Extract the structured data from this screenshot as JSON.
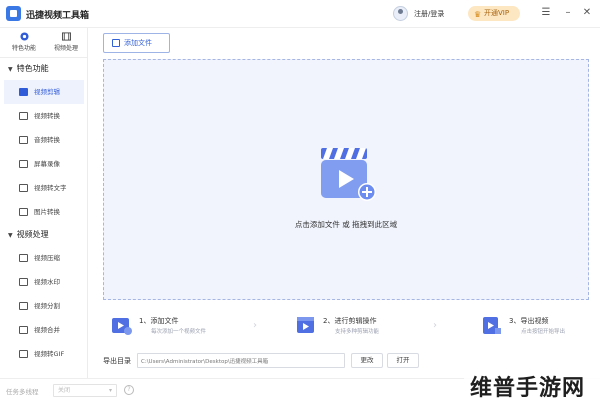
{
  "app": {
    "title": "迅捷视频工具箱"
  },
  "header": {
    "login_label": "注册/登录",
    "vip_label": "开通VIP"
  },
  "sidebar": {
    "top_tabs": [
      {
        "label": "特色功能"
      },
      {
        "label": "视频处理"
      }
    ],
    "sections": [
      {
        "title": "特色功能",
        "items": [
          "视频剪辑",
          "视频转换",
          "音频转换",
          "屏幕录像",
          "视频转文字",
          "图片转换"
        ]
      },
      {
        "title": "视频处理",
        "items": [
          "视频压缩",
          "视频水印",
          "视频分割",
          "视频合并",
          "视频转GIF"
        ]
      }
    ],
    "active_item": "视频剪辑"
  },
  "main": {
    "add_file_label": "添加文件",
    "drop_text": "点击添加文件 或 拖拽到此区域",
    "steps": [
      {
        "title": "1、添加文件",
        "desc": "每次添加一个视频文件"
      },
      {
        "title": "2、进行剪辑操作",
        "desc": "支持多种剪辑功能"
      },
      {
        "title": "3、导出视频",
        "desc": "点击按钮开始导出"
      }
    ],
    "output": {
      "label": "导出目录",
      "path": "C:\\Users\\Administrator\\Desktop\\迅捷视频工具箱",
      "change_label": "更改",
      "open_label": "打开"
    }
  },
  "status": {
    "threads_label": "任务多线程",
    "threads_value": "关闭"
  },
  "watermark": "维普手游网",
  "colors": {
    "accent": "#3361d8",
    "drop_bg": "#f1f4fd",
    "vip_bg": "#fde6c2"
  }
}
